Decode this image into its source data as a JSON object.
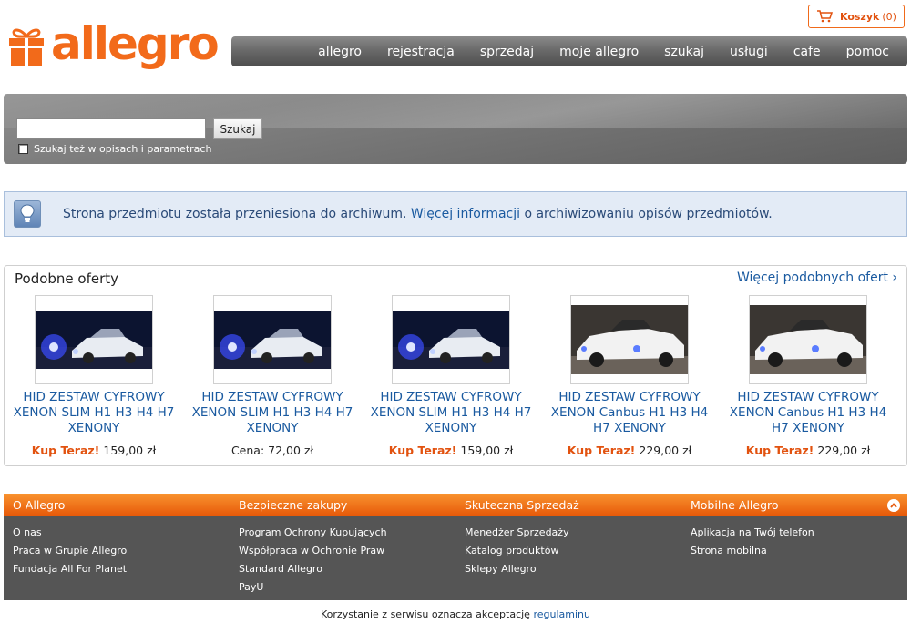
{
  "cart": {
    "label": "Koszyk",
    "count": "(0)"
  },
  "logo": {
    "text": "allegro"
  },
  "nav": [
    "allegro",
    "rejestracja",
    "sprzedaj",
    "moje allegro",
    "szukaj",
    "usługi",
    "cafe",
    "pomoc"
  ],
  "search": {
    "value": "",
    "button_label": "Szukaj",
    "checkbox_label": "Szukaj też w opisach i parametrach"
  },
  "info": {
    "text_before": "Strona przedmiotu została przeniesiona do archiwum. ",
    "link": "Więcej informacji",
    "text_after": " o archiwizowaniu opisów przedmiotów."
  },
  "similar": {
    "title": "Podobne oferty",
    "more_link": "Więcej podobnych ofert ›",
    "offers": [
      {
        "title": "HID ZESTAW CYFROWY XENON SLIM H1 H3 H4 H7 XENONY",
        "price_label": "Kup Teraz!",
        "price": "159,00 zł",
        "image": "car-night-xenon"
      },
      {
        "title": "HID ZESTAW CYFROWY XENON SLIM H1 H3 H4 H7 XENONY",
        "price_label": "Cena:",
        "price": "72,00 zł",
        "image": "car-night-xenon"
      },
      {
        "title": "HID ZESTAW CYFROWY XENON SLIM H1 H3 H4 H7 XENONY",
        "price_label": "Kup Teraz!",
        "price": "159,00 zł",
        "image": "car-night-xenon"
      },
      {
        "title": "HID ZESTAW CYFROWY XENON Canbus H1 H3 H4 H7 XENONY",
        "price_label": "Kup Teraz!",
        "price": "229,00 zł",
        "image": "white-roadster"
      },
      {
        "title": "HID ZESTAW CYFROWY XENON Canbus H1 H3 H4 H7 XENONY",
        "price_label": "Kup Teraz!",
        "price": "229,00 zł",
        "image": "white-roadster"
      }
    ]
  },
  "footer": {
    "columns": [
      {
        "heading": "O Allegro",
        "links": [
          "O nas",
          "Praca w Grupie Allegro",
          "Fundacja All For Planet"
        ]
      },
      {
        "heading": "Bezpieczne zakupy",
        "links": [
          "Program Ochrony Kupujących",
          "Współpraca w Ochronie Praw",
          "Standard Allegro",
          "PayU"
        ]
      },
      {
        "heading": "Skuteczna Sprzedaż",
        "links": [
          "Menedżer Sprzedaży",
          "Katalog produktów",
          "Sklepy Allegro"
        ]
      },
      {
        "heading": "Mobilne Allegro",
        "links": [
          "Aplikacja na Twój telefon",
          "Strona mobilna"
        ]
      }
    ]
  },
  "legal": {
    "text": "Korzystanie z serwisu oznacza akceptację ",
    "link": "regulaminu"
  },
  "colors": {
    "brand_orange": "#f26a1a",
    "link_blue": "#1a5aa0",
    "nav_gray": "#6a6a6a",
    "footer_gray": "#555555"
  }
}
